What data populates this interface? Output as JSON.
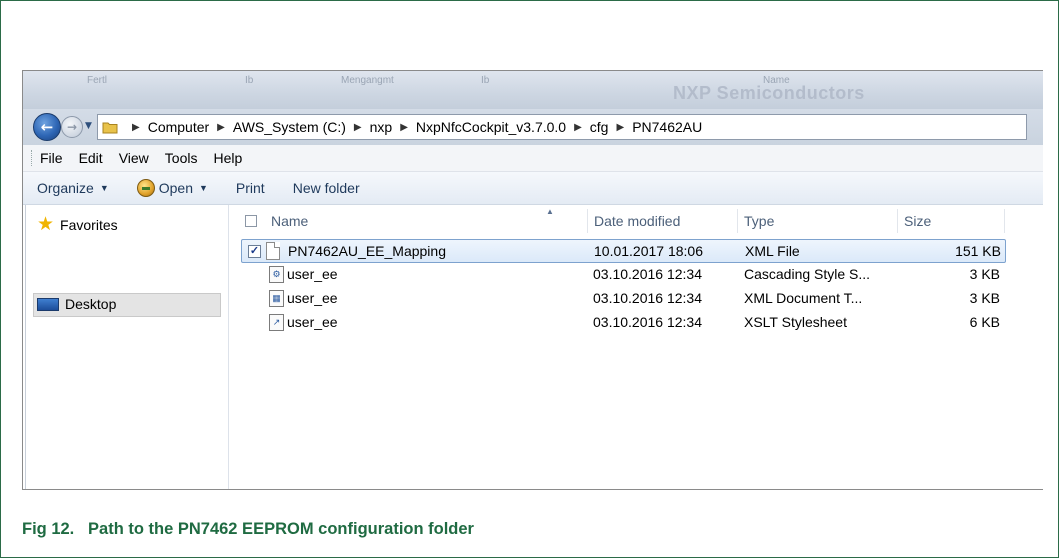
{
  "window": {
    "title_ghost": [
      "Fertl",
      "Ib",
      "Mengangmt",
      "Ib",
      "Name"
    ],
    "brand_ghost": "NXP Semiconductors"
  },
  "address_bar": {
    "crumbs": [
      "Computer",
      "AWS_System (C:)",
      "nxp",
      "NxpNfcCockpit_v3.7.0.0",
      "cfg",
      "PN7462AU"
    ]
  },
  "menu": {
    "items": [
      "File",
      "Edit",
      "View",
      "Tools",
      "Help"
    ]
  },
  "command_bar": {
    "organize": "Organize",
    "open": "Open",
    "print": "Print",
    "new_folder": "New folder"
  },
  "nav_pane": {
    "favorites": "Favorites",
    "desktop": "Desktop"
  },
  "file_list": {
    "columns": [
      "Name",
      "Date modified",
      "Type",
      "Size"
    ],
    "rows": [
      {
        "name": "PN7462AU_EE_Mapping",
        "date": "10.01.2017 18:06",
        "type": "XML File",
        "size": "151 KB",
        "selected": true
      },
      {
        "name": "user_ee",
        "date": "03.10.2016 12:34",
        "type": "Cascading Style S...",
        "size": "3 KB",
        "selected": false
      },
      {
        "name": "user_ee",
        "date": "03.10.2016 12:34",
        "type": "XML Document T...",
        "size": "3 KB",
        "selected": false
      },
      {
        "name": "user_ee",
        "date": "03.10.2016 12:34",
        "type": "XSLT Stylesheet",
        "size": "6 KB",
        "selected": false
      }
    ]
  },
  "caption": "Fig 12.   Path to the PN7462 EEPROM configuration folder",
  "colors": {
    "frame": "#2b6b47",
    "caption": "#1f6b42",
    "selection_border": "#7da2ce",
    "favorites_star": "#f0b400"
  },
  "icons": [
    "back-arrow-icon",
    "forward-arrow-icon",
    "folder-icon",
    "breadcrumb-separator-icon",
    "open-icon",
    "star-icon",
    "desktop-icon",
    "document-icon",
    "css-file-icon",
    "xml-doc-icon",
    "xslt-file-icon",
    "sort-arrow-icon",
    "checkbox-icon"
  ]
}
